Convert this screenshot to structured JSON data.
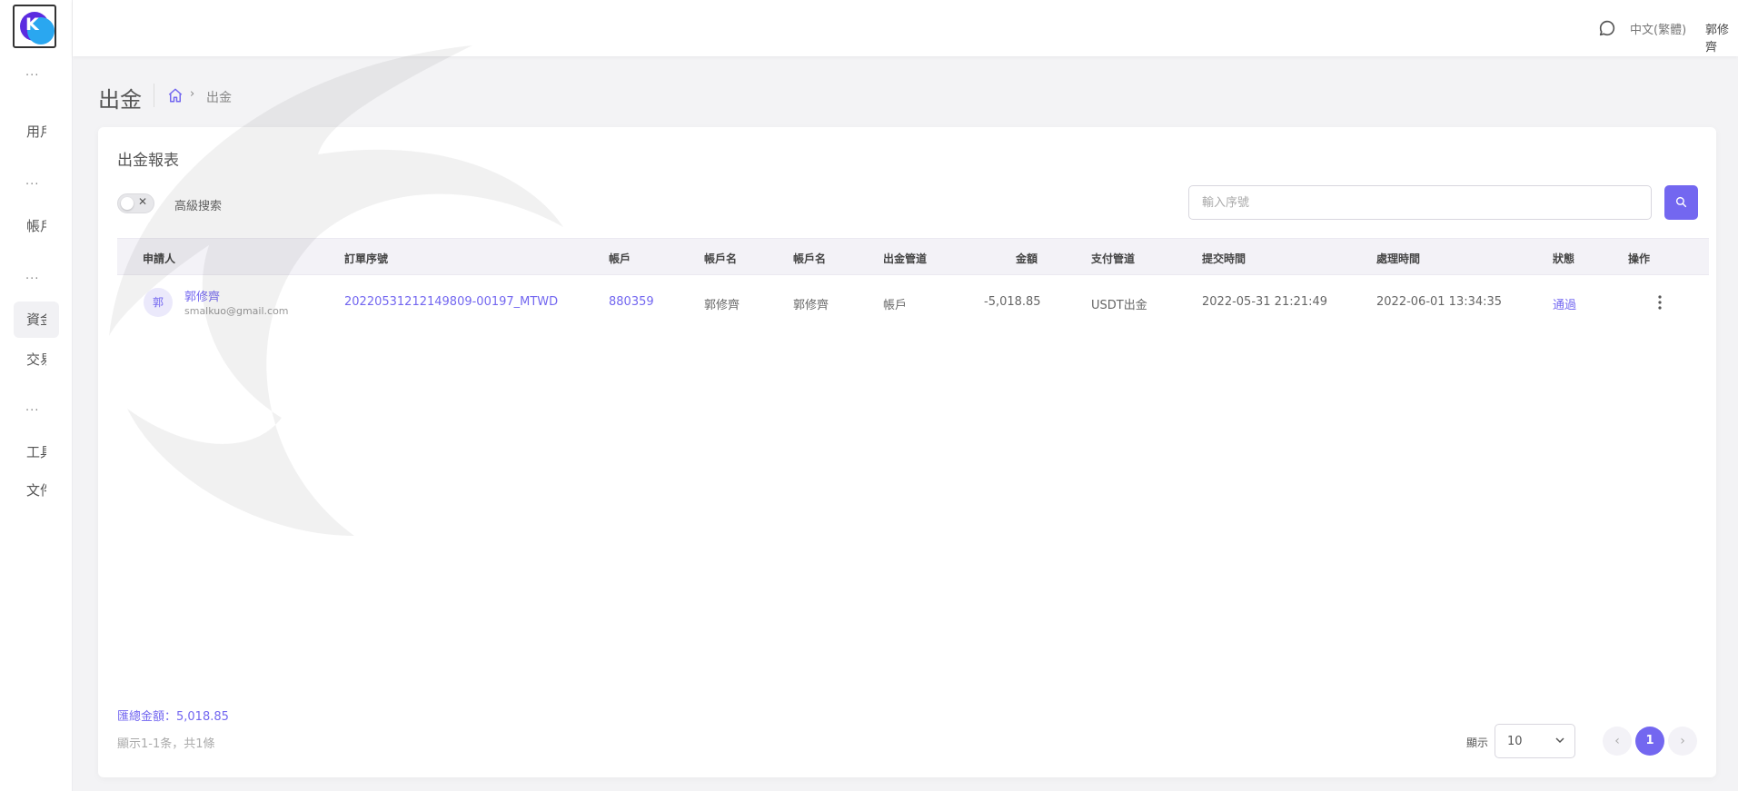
{
  "app": {
    "logo_letter": "K"
  },
  "sidebar": {
    "dots": "···",
    "items": [
      {
        "label": "用戶",
        "active": false
      },
      {
        "label": "帳戶",
        "active": false
      },
      {
        "label": "資金",
        "active": true
      },
      {
        "label": "交易",
        "active": false
      },
      {
        "label": "工具",
        "active": false
      },
      {
        "label": "文件",
        "active": false
      }
    ]
  },
  "header": {
    "language": "中文(繁體)",
    "username": "郭修齊",
    "avatar_text": "郭",
    "online_color": "#28c76f"
  },
  "page": {
    "title": "出金",
    "breadcrumb_sep": "›",
    "breadcrumb_current": "出金"
  },
  "card": {
    "title": "出金報表",
    "advanced_search_label": "高級搜索",
    "toggle_x": "✕",
    "search_placeholder": "輸入序號"
  },
  "table": {
    "headers": [
      "申請人",
      "訂單序號",
      "帳戶",
      "帳戶名",
      "帳戶名",
      "出金管道",
      "金額",
      "支付管道",
      "提交時間",
      "處理時間",
      "狀態",
      "操作"
    ],
    "rows": [
      {
        "avatar": "郭",
        "name": "郭修齊",
        "email": "smalkuo@gmail.com",
        "order_no": "20220531212149809-00197_MTWD",
        "account": "880359",
        "account_name_1": "郭修齊",
        "account_name_2": "郭修齊",
        "channel": "帳戶",
        "amount": "-5,018.85",
        "payment": "USDT出金",
        "submitted": "2022-05-31 21:21:49",
        "processed": "2022-06-01 13:34:35",
        "status": "通過"
      }
    ]
  },
  "footer": {
    "total": "匯總金額：5,018.85",
    "showing": "顯示1-1条，共1條",
    "show_label": "顯示",
    "page_size": "10",
    "prev": "‹",
    "current_page": "1",
    "next": "›"
  },
  "colors": {
    "accent": "#7367f0"
  }
}
